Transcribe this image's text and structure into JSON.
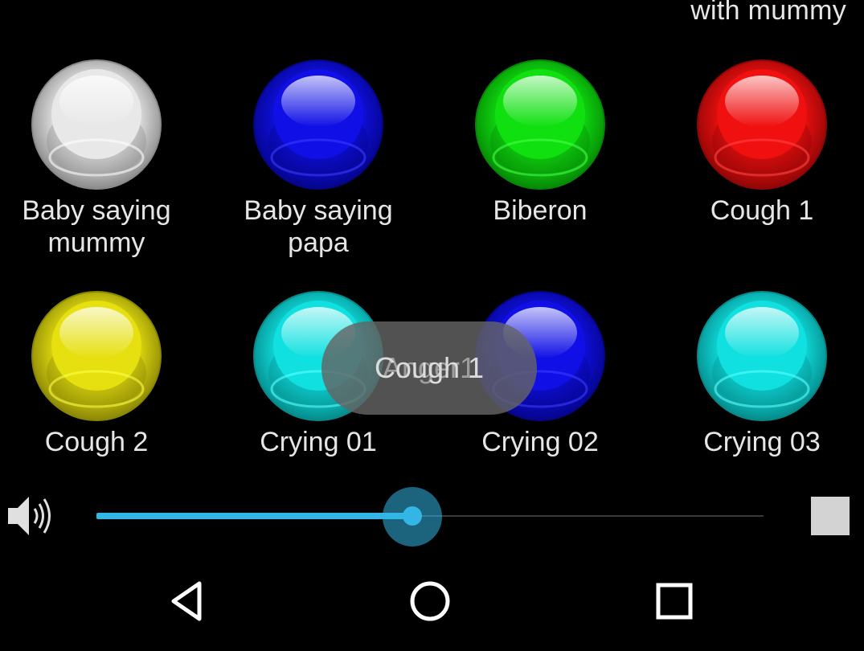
{
  "header": {
    "partial_label": "with mummy"
  },
  "buttons": [
    {
      "label": "Baby saying\nmummy",
      "color": "#e8e8e8",
      "dark": "#8a8a8a",
      "light": "#ffffff"
    },
    {
      "label": "Baby saying\npapa",
      "color": "#1010e6",
      "dark": "#05058a",
      "light": "#3a3aff"
    },
    {
      "label": "Biberon",
      "color": "#10e010",
      "dark": "#068806",
      "light": "#44ff44"
    },
    {
      "label": "Cough 1",
      "color": "#f01010",
      "dark": "#900606",
      "light": "#ff4444"
    },
    {
      "label": "Cough 2",
      "color": "#e6e010",
      "dark": "#8a8606",
      "light": "#ffff44"
    },
    {
      "label": "Crying 01",
      "color": "#10e0e0",
      "dark": "#068a8a",
      "light": "#5affff"
    },
    {
      "label": "Crying 02",
      "color": "#1010e6",
      "dark": "#05058a",
      "light": "#3a3aff"
    },
    {
      "label": "Crying 03",
      "color": "#10e0e0",
      "dark": "#068a8a",
      "light": "#5affff"
    }
  ],
  "toast": {
    "text": "Cough 1",
    "previous_text": "Anger1"
  },
  "player": {
    "volume_icon": "speaker-volume-icon",
    "progress": 0.465,
    "accent": "#33b5e5",
    "stop_icon": "stop-icon"
  },
  "navigation": {
    "back_icon": "back-triangle-icon",
    "home_icon": "home-circle-icon",
    "recents_icon": "recents-square-icon"
  }
}
